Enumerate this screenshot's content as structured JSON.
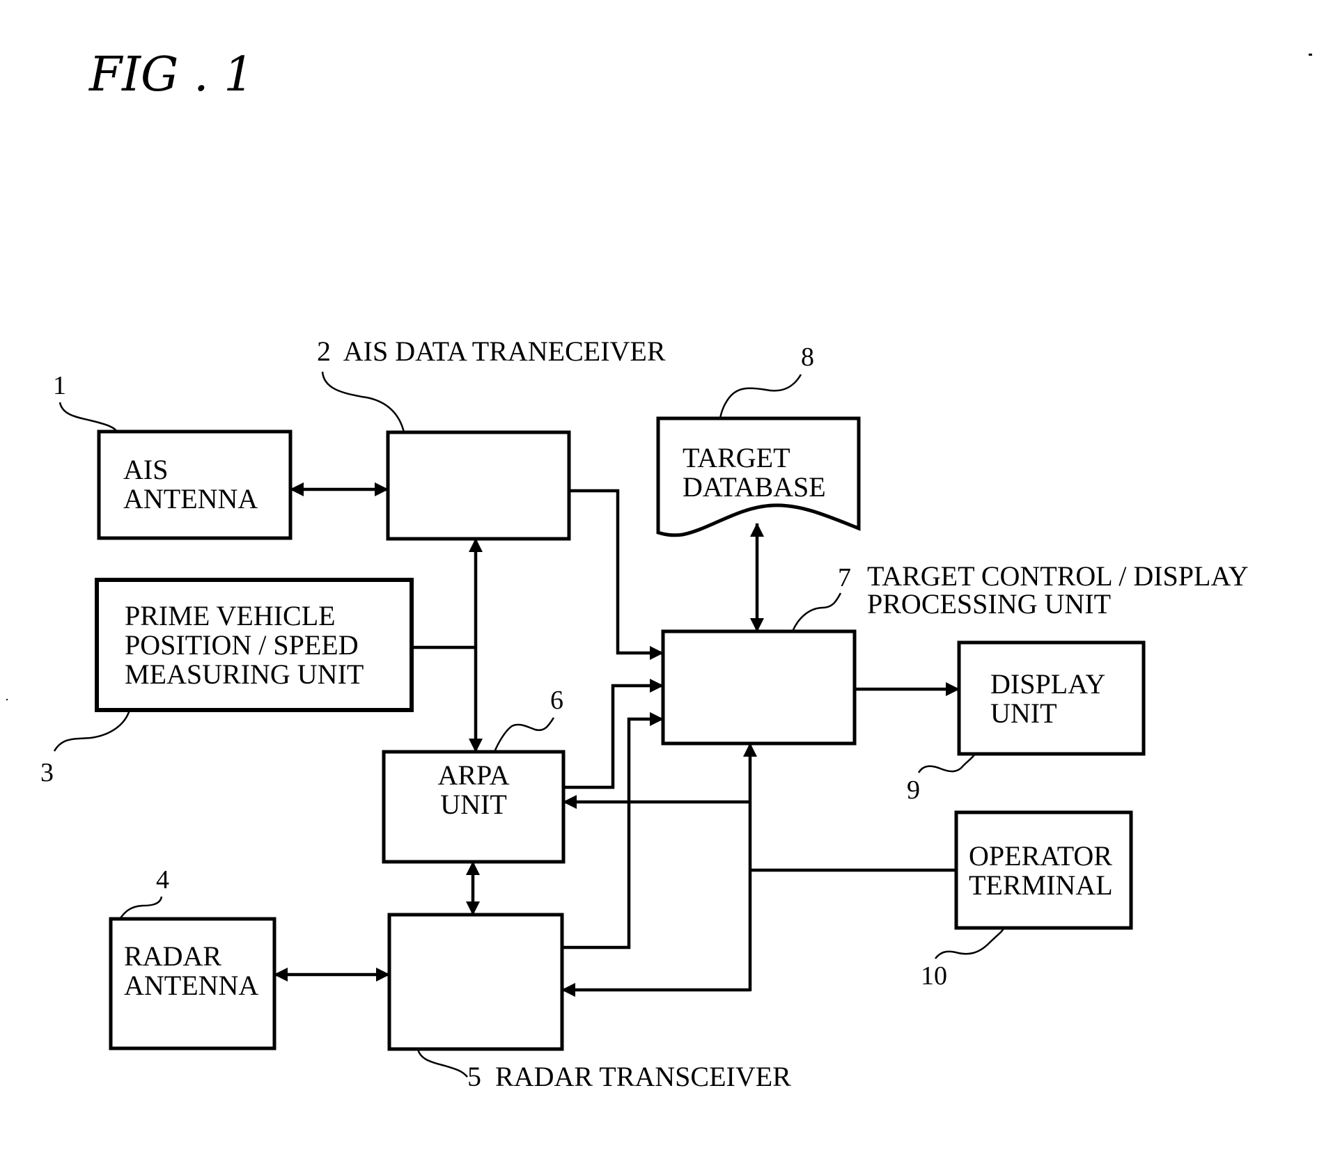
{
  "figure": {
    "title": "FIG . 1"
  },
  "blocks": {
    "ais_antenna": {
      "number": "1",
      "lines": [
        "AIS",
        "ANTENNA"
      ]
    },
    "ais_transceiver": {
      "number": "2",
      "caption": "2  AIS DATA TRANECEIVER"
    },
    "position_unit": {
      "number": "3",
      "lines": [
        "PRIME VEHICLE",
        "POSITION / SPEED",
        "MEASURING UNIT"
      ]
    },
    "radar_antenna": {
      "number": "4",
      "lines": [
        "RADAR",
        "ANTENNA"
      ]
    },
    "radar_transceiver": {
      "number": "5",
      "caption": "5  RADAR TRANSCEIVER"
    },
    "arpa_unit": {
      "number": "6",
      "lines": [
        "ARPA",
        "UNIT"
      ]
    },
    "processing_unit": {
      "number": "7",
      "caption_lines": [
        "TARGET CONTROL / DISPLAY",
        "PROCESSING UNIT"
      ]
    },
    "target_database": {
      "number": "8",
      "lines": [
        "TARGET",
        "DATABASE"
      ]
    },
    "display_unit": {
      "number": "9",
      "lines": [
        "DISPLAY",
        "UNIT"
      ]
    },
    "operator_terminal": {
      "number": "10",
      "lines": [
        "OPERATOR",
        "TERMINAL"
      ]
    }
  },
  "connections": [
    {
      "from": "AIS ANTENNA",
      "to": "AIS DATA TRANECEIVER",
      "type": "bidirectional"
    },
    {
      "from": "AIS DATA TRANECEIVER",
      "to": "TARGET CONTROL / DISPLAY PROCESSING UNIT",
      "type": "directed"
    },
    {
      "from": "AIS DATA TRANECEIVER",
      "to": "ARPA UNIT",
      "type": "bidirectional"
    },
    {
      "from": "PRIME VEHICLE POSITION / SPEED MEASURING UNIT",
      "to": "AIS DATA TRANECEIVER / ARPA UNIT bus",
      "type": "line"
    },
    {
      "from": "ARPA UNIT",
      "to": "TARGET CONTROL / DISPLAY PROCESSING UNIT",
      "type": "directed"
    },
    {
      "from": "RADAR TRANSCEIVER",
      "to": "TARGET CONTROL / DISPLAY PROCESSING UNIT",
      "type": "directed"
    },
    {
      "from": "ARPA UNIT",
      "to": "RADAR TRANSCEIVER",
      "type": "bidirectional"
    },
    {
      "from": "RADAR ANTENNA",
      "to": "RADAR TRANSCEIVER",
      "type": "bidirectional"
    },
    {
      "from": "TARGET DATABASE",
      "to": "TARGET CONTROL / DISPLAY PROCESSING UNIT",
      "type": "bidirectional"
    },
    {
      "from": "TARGET CONTROL / DISPLAY PROCESSING UNIT",
      "to": "DISPLAY UNIT",
      "type": "directed"
    },
    {
      "from": "OPERATOR TERMINAL",
      "to": "TARGET CONTROL / DISPLAY PROCESSING UNIT",
      "type": "directed"
    },
    {
      "from": "OPERATOR TERMINAL",
      "to": "ARPA UNIT",
      "type": "directed"
    },
    {
      "from": "OPERATOR TERMINAL",
      "to": "RADAR TRANSCEIVER",
      "type": "directed"
    }
  ]
}
